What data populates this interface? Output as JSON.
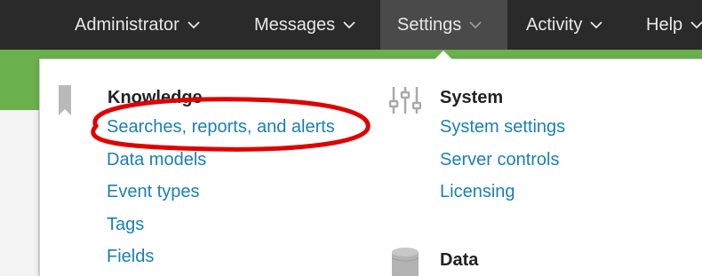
{
  "topnav": {
    "items": [
      {
        "label": "Administrator"
      },
      {
        "label": "Messages"
      },
      {
        "label": "Settings"
      },
      {
        "label": "Activity"
      },
      {
        "label": "Help"
      }
    ]
  },
  "dropdown": {
    "knowledge": {
      "title": "Knowledge",
      "links": [
        "Searches, reports, and alerts",
        "Data models",
        "Event types",
        "Tags",
        "Fields"
      ]
    },
    "system": {
      "title": "System",
      "links": [
        "System settings",
        "Server controls",
        "Licensing"
      ]
    },
    "data": {
      "title": "Data"
    }
  },
  "colors": {
    "topbar": "#2a2a2a",
    "active_tab": "#4a4a4a",
    "green_bar": "#6ab04c",
    "link": "#1a80b6",
    "annotation": "#e00000"
  },
  "icons": {
    "knowledge": "bookmark-icon",
    "system": "sliders-icon",
    "data": "database-icon",
    "chevron": "chevron-down-icon"
  }
}
